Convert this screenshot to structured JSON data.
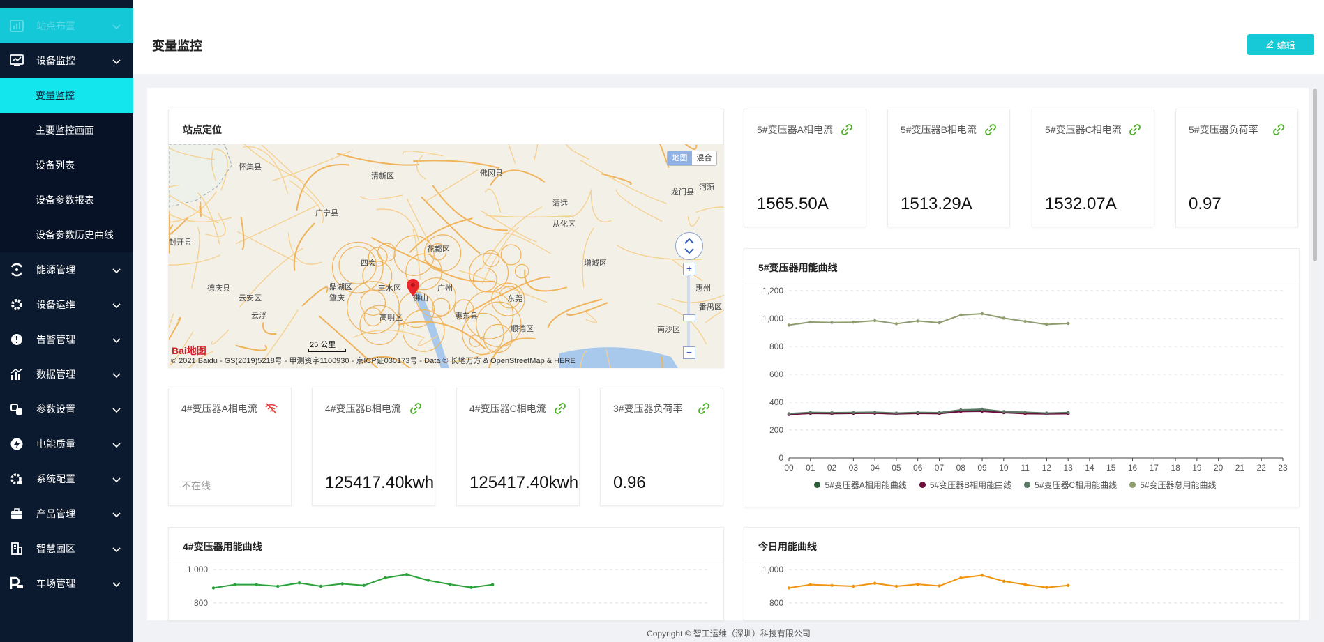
{
  "sidebar": {
    "top_item": "站点布置",
    "items": [
      {
        "label": "设备监控",
        "icon": "monitor-chart-icon"
      },
      {
        "label": "能源管理",
        "icon": "energy-icon"
      },
      {
        "label": "设备运维",
        "icon": "gear-icon"
      },
      {
        "label": "告警管理",
        "icon": "alarm-icon"
      },
      {
        "label": "数据管理",
        "icon": "bar-chart-icon"
      },
      {
        "label": "参数设置",
        "icon": "params-icon"
      },
      {
        "label": "电能质量",
        "icon": "lightning-icon"
      },
      {
        "label": "系统配置",
        "icon": "settings-icon"
      },
      {
        "label": "产品管理",
        "icon": "briefcase-icon"
      },
      {
        "label": "智慧园区",
        "icon": "building-icon"
      },
      {
        "label": "车场管理",
        "icon": "parking-icon"
      }
    ],
    "sub_items": [
      "变量监控",
      "主要监控画面",
      "设备列表",
      "设备参数报表",
      "设备参数历史曲线"
    ]
  },
  "header": {
    "title": "变量监控",
    "edit_label": "编辑"
  },
  "map_card": {
    "title": "站点定位",
    "map_type_1": "地图",
    "map_type_2": "混合",
    "scale": "25 公里",
    "copyright": "© 2021 Baidu - GS(2019)5218号 - 甲测资字1100930 - 京ICP证030173号 - Data © 长地万方 & OpenStreetMap & HERE",
    "logo": "Bai地图",
    "places": [
      "怀集县",
      "清新区",
      "佛冈县",
      "清远",
      "龙门县",
      "河源",
      "广宁县",
      "从化区",
      "封开县",
      "花都区",
      "四会",
      "增城区",
      "德庆县",
      "鼎湖区",
      "三水区",
      "广州",
      "惠州",
      "云安区",
      "肇庆",
      "佛山",
      "东莞",
      "云浮",
      "高明区",
      "番禺区",
      "惠东县",
      "顺德区",
      "南沙区",
      "惠阳区"
    ]
  },
  "top_metrics": [
    {
      "label": "5#变压器A相电流",
      "value": "1565.50A"
    },
    {
      "label": "5#变压器B相电流",
      "value": "1513.29A"
    },
    {
      "label": "5#变压器C相电流",
      "value": "1532.07A"
    },
    {
      "label": "5#变压器负荷率",
      "value": "0.97"
    }
  ],
  "bottom_metrics": [
    {
      "label": "4#变压器A相电流",
      "value": "",
      "status": "不在线"
    },
    {
      "label": "4#变压器B相电流",
      "value": "125417.40kwh"
    },
    {
      "label": "4#变压器C相电流",
      "value": "125417.40kwh"
    },
    {
      "label": "3#变压器负荷率",
      "value": "0.96"
    }
  ],
  "chart_titles": {
    "c5": "5#变压器用能曲线",
    "c4": "4#变压器用能曲线",
    "today": "今日用能曲线"
  },
  "footer": "Copyright © 智工运维（深圳）科技有限公司",
  "chart_data": [
    {
      "type": "line",
      "title": "5#变压器用能曲线",
      "x": [
        "00",
        "01",
        "02",
        "03",
        "04",
        "05",
        "06",
        "07",
        "08",
        "09",
        "10",
        "11",
        "12",
        "13",
        "14",
        "15",
        "16",
        "17",
        "18",
        "19",
        "20",
        "21",
        "22",
        "23"
      ],
      "ylim": [
        0,
        1200
      ],
      "yticks": [
        0,
        200,
        400,
        600,
        800,
        "1,000",
        "1,200"
      ],
      "series": [
        {
          "name": "5#变压器A相用能曲线",
          "color": "#2e5e3a",
          "values": [
            315,
            322,
            320,
            321,
            323,
            318,
            322,
            320,
            338,
            342,
            328,
            322,
            318,
            320
          ]
        },
        {
          "name": "5#变压器B相用能曲线",
          "color": "#6b0f3c",
          "values": [
            312,
            320,
            318,
            320,
            321,
            316,
            320,
            318,
            333,
            335,
            325,
            318,
            316,
            318
          ]
        },
        {
          "name": "5#变压器C相用能曲线",
          "color": "#5b7a66",
          "values": [
            318,
            327,
            325,
            326,
            328,
            322,
            327,
            325,
            345,
            350,
            333,
            328,
            322,
            326
          ]
        },
        {
          "name": "5#变压器总用能曲线",
          "color": "#8f9c6e",
          "values": [
            953,
            975,
            972,
            974,
            985,
            963,
            983,
            970,
            1025,
            1035,
            1003,
            980,
            958,
            965
          ]
        }
      ]
    },
    {
      "type": "line",
      "title": "4#变压器用能曲线",
      "yticks": [
        "1,000",
        800
      ],
      "series": [
        {
          "color": "#2aa13a",
          "values": [
            890,
            910,
            910,
            900,
            920,
            900,
            915,
            905,
            950,
            970,
            935,
            912,
            893,
            910
          ]
        }
      ]
    },
    {
      "type": "line",
      "title": "今日用能曲线",
      "yticks": [
        "1,000",
        800
      ],
      "series": [
        {
          "color": "#f0930f",
          "values": [
            890,
            910,
            905,
            900,
            918,
            900,
            912,
            902,
            950,
            965,
            930,
            910,
            893,
            905
          ]
        }
      ]
    }
  ]
}
